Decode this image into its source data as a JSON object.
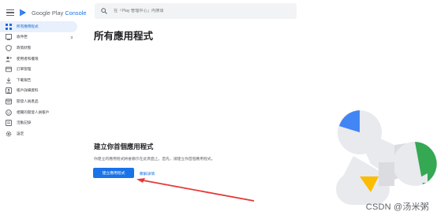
{
  "brand": {
    "name_prefix": "Google Play",
    "name_suffix": "Console"
  },
  "search": {
    "placeholder": "在「Play 管理中心」內搜尋"
  },
  "sidebar": {
    "items": [
      {
        "label": "所有應用程式",
        "icon": "apps-grid-icon",
        "active": true,
        "count": ""
      },
      {
        "label": "收件匣",
        "icon": "inbox-icon",
        "active": false,
        "count": "3"
      },
      {
        "label": "政策狀態",
        "icon": "shield-icon",
        "active": false,
        "count": ""
      },
      {
        "label": "使用者和權限",
        "icon": "users-icon",
        "active": false,
        "count": ""
      },
      {
        "label": "訂單管理",
        "icon": "card-icon",
        "active": false,
        "count": ""
      },
      {
        "label": "下載報告",
        "icon": "download-icon",
        "active": false,
        "count": ""
      },
      {
        "label": "帳戶詳細資料",
        "icon": "account-icon",
        "active": false,
        "count": ""
      },
      {
        "label": "開發人員產品",
        "icon": "developer-icon",
        "active": false,
        "count": ""
      },
      {
        "label": "相關的開發人員帳戶",
        "icon": "linked-accounts-icon",
        "active": false,
        "count": ""
      },
      {
        "label": "活動記錄",
        "icon": "activity-icon",
        "active": false,
        "count": ""
      },
      {
        "label": "設定",
        "icon": "gear-icon",
        "active": false,
        "count": ""
      }
    ]
  },
  "main": {
    "title": "所有應用程式",
    "create_title": "建立你首個應用程式",
    "create_desc": "你建立的應用程式將會顯示在此頁面上。首先，請建立你首個應用程式。",
    "create_button": "建立應用程式",
    "learn_more": "瞭解詳情"
  },
  "watermark": "CSDN @汤米粥",
  "colors": {
    "accent": "#1a73e8",
    "active_bg": "#e8f0fe",
    "arrow": "#e53935"
  }
}
